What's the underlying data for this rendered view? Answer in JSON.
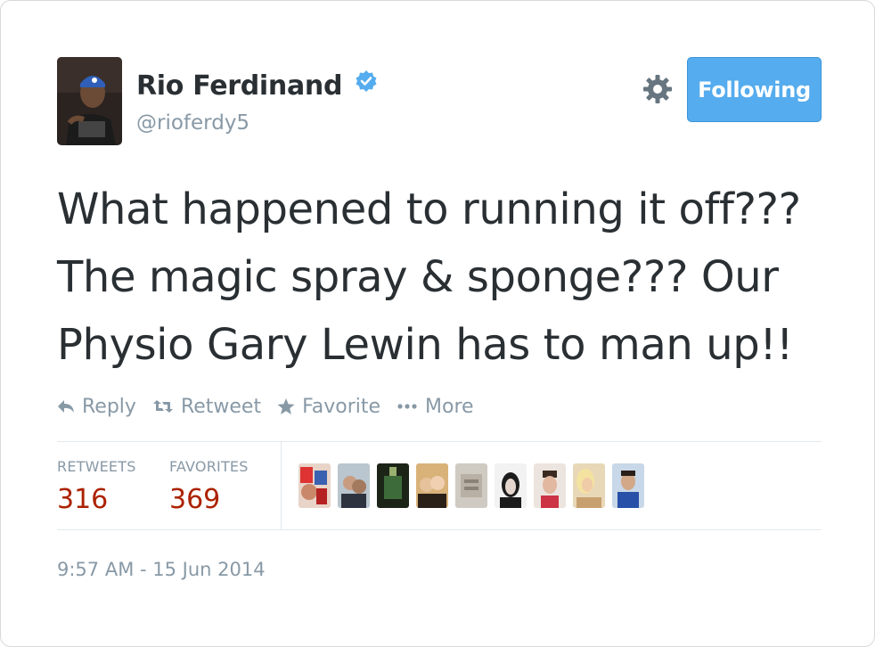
{
  "author": {
    "name": "Rio Ferdinand",
    "handle": "@rioferdy5",
    "verified": true,
    "avatar_icon": "profile-photo"
  },
  "follow_button": {
    "label": "Following",
    "color": "#55acee"
  },
  "tweet": {
    "text": "What happened to running it off??? The magic spray & sponge??? Our Physio Gary Lewin has to man up!!"
  },
  "actions": [
    {
      "label": "Reply",
      "icon": "reply-icon"
    },
    {
      "label": "Retweet",
      "icon": "retweet-icon"
    },
    {
      "label": "Favorite",
      "icon": "star-icon"
    },
    {
      "label": "More",
      "icon": "more-dots-icon"
    }
  ],
  "stats": {
    "retweets": {
      "label": "RETWEETS",
      "value": "316"
    },
    "favorites": {
      "label": "FAVORITES",
      "value": "369"
    },
    "value_color": "#ac2200"
  },
  "favoriters": [
    {
      "icon": "user-avatar"
    },
    {
      "icon": "user-avatar"
    },
    {
      "icon": "user-avatar"
    },
    {
      "icon": "user-avatar"
    },
    {
      "icon": "user-avatar"
    },
    {
      "icon": "user-avatar"
    },
    {
      "icon": "user-avatar"
    },
    {
      "icon": "user-avatar"
    },
    {
      "icon": "user-avatar"
    }
  ],
  "timestamp": "9:57 AM - 15 Jun 2014"
}
